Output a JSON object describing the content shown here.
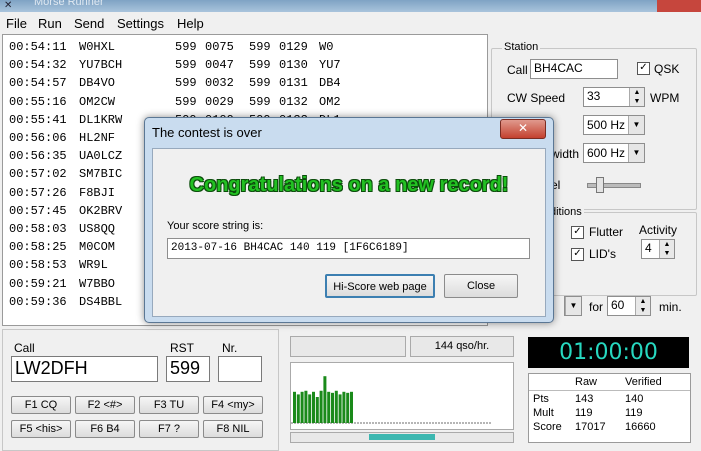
{
  "window": {
    "title": "Morse Runner"
  },
  "menu": [
    "File",
    "Run",
    "Send",
    "Settings",
    "Help"
  ],
  "log": [
    {
      "time": "00:54:11",
      "call": "W0HXL",
      "rst1": "599",
      "nr1": "0075",
      "rst2": "599",
      "nr2": "0129",
      "pfx": "W0"
    },
    {
      "time": "00:54:32",
      "call": "YU7BCH",
      "rst1": "599",
      "nr1": "0047",
      "rst2": "599",
      "nr2": "0130",
      "pfx": "YU7"
    },
    {
      "time": "00:54:57",
      "call": "DB4VO",
      "rst1": "599",
      "nr1": "0032",
      "rst2": "599",
      "nr2": "0131",
      "pfx": "DB4"
    },
    {
      "time": "00:55:16",
      "call": "OM2CW",
      "rst1": "599",
      "nr1": "0029",
      "rst2": "599",
      "nr2": "0132",
      "pfx": "OM2"
    },
    {
      "time": "00:55:41",
      "call": "DL1KRW",
      "rst1": "599",
      "nr1": "0109",
      "rst2": "599",
      "nr2": "0133",
      "pfx": "DL1"
    },
    {
      "time": "00:56:06",
      "call": "HL2NF",
      "rst1": "",
      "nr1": "",
      "rst2": "",
      "nr2": "",
      "pfx": ""
    },
    {
      "time": "00:56:35",
      "call": "UA0LCZ",
      "rst1": "",
      "nr1": "",
      "rst2": "",
      "nr2": "",
      "pfx": ""
    },
    {
      "time": "00:57:02",
      "call": "SM7BIC",
      "rst1": "",
      "nr1": "",
      "rst2": "",
      "nr2": "",
      "pfx": ""
    },
    {
      "time": "00:57:26",
      "call": "F8BJI",
      "rst1": "",
      "nr1": "",
      "rst2": "",
      "nr2": "",
      "pfx": ""
    },
    {
      "time": "00:57:45",
      "call": "OK2BRV",
      "rst1": "",
      "nr1": "",
      "rst2": "",
      "nr2": "",
      "pfx": ""
    },
    {
      "time": "00:58:03",
      "call": "US8QQ",
      "rst1": "",
      "nr1": "",
      "rst2": "",
      "nr2": "",
      "pfx": ""
    },
    {
      "time": "00:58:25",
      "call": "M0COM",
      "rst1": "",
      "nr1": "",
      "rst2": "",
      "nr2": "",
      "pfx": ""
    },
    {
      "time": "00:58:53",
      "call": "WR9L",
      "rst1": "",
      "nr1": "",
      "rst2": "",
      "nr2": "",
      "pfx": ""
    },
    {
      "time": "00:59:21",
      "call": "W7BBO",
      "rst1": "",
      "nr1": "",
      "rst2": "",
      "nr2": "",
      "pfx": ""
    },
    {
      "time": "00:59:36",
      "call": "DS4BBL",
      "rst1": "",
      "nr1": "",
      "rst2": "",
      "nr2": "",
      "pfx": ""
    }
  ],
  "station": {
    "group_label": "Station",
    "call_label": "Call",
    "call_value": "BH4CAC",
    "qsk_label": "QSK",
    "qsk_checked": true,
    "cw_speed_label": "CW Speed",
    "cw_speed_value": "33",
    "wpm_label": "WPM",
    "pitch_value": "500 Hz",
    "bandwidth_label": "width",
    "bandwidth_value": "600 Hz",
    "mon_label": "el"
  },
  "conditions": {
    "group_label": "ditions",
    "flutter_label": "Flutter",
    "flutter_checked": true,
    "lids_label": "LID's",
    "lids_checked": true,
    "activity_label": "Activity",
    "activity_value": "4"
  },
  "run": {
    "for_label": "for",
    "minutes_value": "60",
    "min_label": "min."
  },
  "dialog": {
    "title": "The contest is over",
    "close_glyph": "✕",
    "message": "Congratulations on a new record!",
    "score_label": "Your score string is:",
    "score_string": "2013-07-16 BH4CAC 140 119 [1F6C6189]",
    "hiscore_button": "Hi-Score web page",
    "close_button": "Close"
  },
  "entry": {
    "call_label": "Call",
    "call_value": "LW2DFH",
    "rst_label": "RST",
    "rst_value": "599",
    "nr_label": "Nr.",
    "nr_value": ""
  },
  "fkeys": [
    "F1 CQ",
    "F2 <#>",
    "F3 TU",
    "F4 <my>",
    "F5 <his>",
    "F6 B4",
    "F7 ?",
    "F8 NIL"
  ],
  "rate": {
    "text": "144 qso/hr."
  },
  "rate_bars": [
    0.6,
    0.55,
    0.6,
    0.62,
    0.55,
    0.6,
    0.5,
    0.62,
    0.9,
    0.6,
    0.58,
    0.62,
    0.55,
    0.6,
    0.58,
    0.6
  ],
  "clock": {
    "time": "01:00:00"
  },
  "score": {
    "col_raw": "Raw",
    "col_verified": "Verified",
    "rows": [
      {
        "label": "Pts",
        "raw": "143",
        "verified": "140"
      },
      {
        "label": "Mult",
        "raw": "119",
        "verified": "119"
      },
      {
        "label": "Score",
        "raw": "17017",
        "verified": "16660"
      }
    ]
  },
  "colors": {
    "accent_green": "#22c022",
    "clock_text": "#27d8c0",
    "bar_green": "#1a8a1a"
  }
}
